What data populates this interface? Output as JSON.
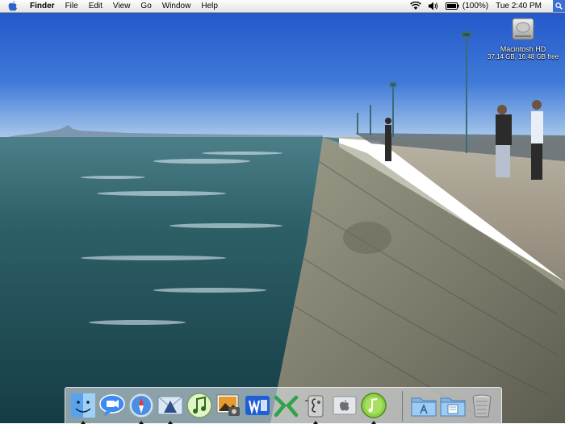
{
  "menubar": {
    "app_name": "Finder",
    "menus": [
      "File",
      "Edit",
      "View",
      "Go",
      "Window",
      "Help"
    ],
    "battery": "(100%)",
    "clock": "Tue 2:40 PM",
    "status_icons": [
      "apple-icon",
      "wifi-icon",
      "volume-icon",
      "battery-icon",
      "spotlight-icon"
    ]
  },
  "desktop": {
    "hd_icon": {
      "name": "Macintosh HD",
      "info": "37.14 GB, 16.48 GB free",
      "icon": "hard-drive-icon"
    }
  },
  "dock": {
    "apps": [
      {
        "id": "finder",
        "icon": "finder-icon",
        "running": true
      },
      {
        "id": "ichat",
        "icon": "ichat-icon",
        "running": false
      },
      {
        "id": "safari",
        "icon": "safari-icon",
        "running": true
      },
      {
        "id": "mail",
        "icon": "mail-icon",
        "running": true
      },
      {
        "id": "itunes",
        "icon": "itunes-icon",
        "running": false
      },
      {
        "id": "iphoto",
        "icon": "iphoto-icon",
        "running": false
      },
      {
        "id": "word",
        "icon": "word-icon",
        "running": false
      },
      {
        "id": "excel",
        "icon": "excel-icon",
        "running": false
      },
      {
        "id": "system-preferences",
        "icon": "system-preferences-icon",
        "running": true
      },
      {
        "id": "apple-app",
        "icon": "apple-icon",
        "running": false
      },
      {
        "id": "garageband",
        "icon": "garageband-icon",
        "running": true
      }
    ],
    "stacks": [
      {
        "id": "applications",
        "icon": "applications-folder-icon"
      },
      {
        "id": "documents",
        "icon": "documents-folder-icon"
      },
      {
        "id": "trash",
        "icon": "trash-icon"
      }
    ]
  },
  "colors": {
    "sky_top": "#1f52c8",
    "sea": "#1d4a52",
    "dock_accent": "#3b6fd3"
  }
}
